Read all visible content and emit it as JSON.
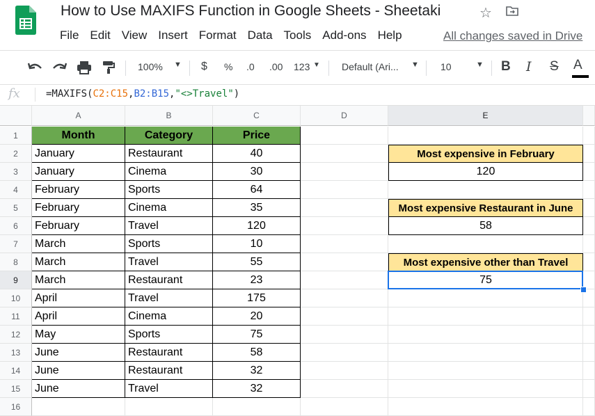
{
  "doc": {
    "title": "How to Use MAXIFS Function in Google Sheets - Sheetaki",
    "saved_status": "All changes saved in Drive"
  },
  "menu": [
    "File",
    "Edit",
    "View",
    "Insert",
    "Format",
    "Data",
    "Tools",
    "Add-ons",
    "Help"
  ],
  "toolbar": {
    "zoom": "100%",
    "currency": "$",
    "percent": "%",
    "decrease_decimal": ".0",
    "increase_decimal": ".00",
    "more_formats": "123",
    "font": "Default (Ari...",
    "font_size": "10",
    "bold": "B",
    "italic": "I",
    "strikethrough": "S",
    "text_color": "A"
  },
  "formula_bar": {
    "fx": "fx",
    "prefix": "=MAXIFS(",
    "range1": "C2:C15",
    "comma1": ",",
    "range2": "B2:B15",
    "comma2": ",",
    "criterion": "\"<>Travel\"",
    "suffix": ")"
  },
  "columns": [
    "A",
    "B",
    "C",
    "D",
    "E"
  ],
  "selected": {
    "column": "E",
    "row": "9"
  },
  "table": {
    "headers": [
      "Month",
      "Category",
      "Price"
    ],
    "rows": [
      [
        "January",
        "Restaurant",
        "40"
      ],
      [
        "January",
        "Cinema",
        "30"
      ],
      [
        "February",
        "Sports",
        "64"
      ],
      [
        "February",
        "Cinema",
        "35"
      ],
      [
        "February",
        "Travel",
        "120"
      ],
      [
        "March",
        "Sports",
        "10"
      ],
      [
        "March",
        "Travel",
        "55"
      ],
      [
        "March",
        "Restaurant",
        "23"
      ],
      [
        "April",
        "Travel",
        "175"
      ],
      [
        "April",
        "Cinema",
        "20"
      ],
      [
        "May",
        "Sports",
        "75"
      ],
      [
        "June",
        "Restaurant",
        "58"
      ],
      [
        "June",
        "Restaurant",
        "32"
      ],
      [
        "June",
        "Travel",
        "32"
      ]
    ]
  },
  "results": [
    {
      "label": "Most expensive in February",
      "value": "120"
    },
    {
      "label": "Most expensive Restaurant in June",
      "value": "58"
    },
    {
      "label": "Most expensive other than Travel",
      "value": "75"
    }
  ],
  "row_numbers": [
    "1",
    "2",
    "3",
    "4",
    "5",
    "6",
    "7",
    "8",
    "9",
    "10",
    "11",
    "12",
    "13",
    "14",
    "15",
    "16"
  ],
  "colors": {
    "header_green": "#6aa84f",
    "result_yellow": "#ffe599",
    "selection_blue": "#1a73e8",
    "logo_green": "#0f9d58"
  }
}
